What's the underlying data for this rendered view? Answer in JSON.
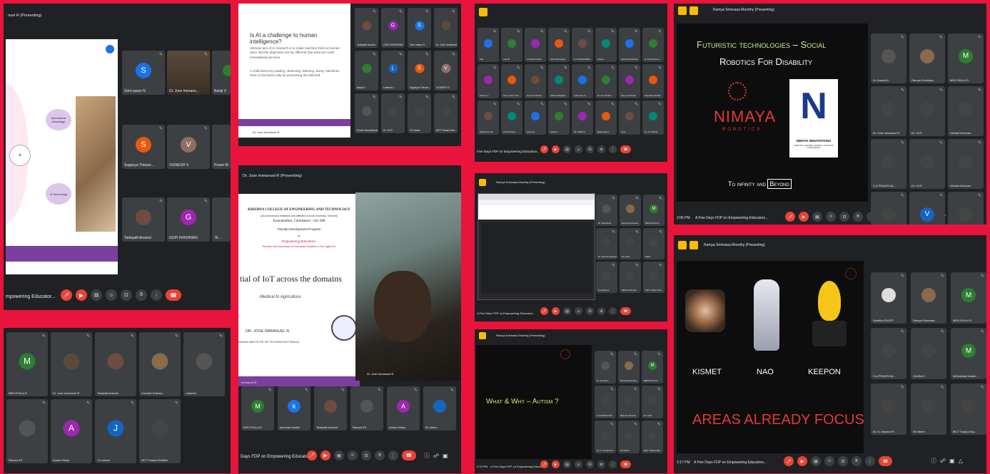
{
  "colors": {
    "background": "#e8143c",
    "panel": "#202124",
    "tile": "#3c4043",
    "end_call": "#ea4335"
  },
  "p1": {
    "presenting": "nuel R (Presenting)",
    "bar_text": "mpowering Educator...",
    "slide": {
      "label_1": "Mechanical Advantage",
      "label_2": "of Technology",
      "label_3": "e"
    },
    "tiles": [
      {
        "name": "Srini vasan N",
        "initial": "S",
        "color": "#1a73e8"
      },
      {
        "name": "Dr. Jose Immanu...",
        "initial": "",
        "color": "#5a4a3a"
      },
      {
        "name": "Balaji V",
        "initial": "",
        "color": "#2e7d32"
      },
      {
        "name": "Suganya Thiruve...",
        "initial": "S",
        "color": "#e8590c"
      },
      {
        "name": "VIGNESH V",
        "initial": "V",
        "color": "#8d6e63"
      },
      {
        "name": "Pravin M",
        "initial": "",
        "color": "#555"
      },
      {
        "name": "Tadepalli Aravind",
        "initial": "",
        "color": "#555"
      },
      {
        "name": "GOPI KRISHNAN",
        "initial": "G",
        "color": "#9c27b0"
      },
      {
        "name": "76 ...",
        "initial": "",
        "color": "#555"
      }
    ]
  },
  "p2": {
    "slide_title": "Is AI a challenge to human intelligence?",
    "para_1": "Ultimate aim of AI research is to make machine think as human does. But the objectives are far different that what we could immediately perceive.",
    "para_2": "A child learns by reading, observing, listening, doing. Machines have so far learnt only by processing the data fed.",
    "footer": "Dr. Jose Immanuel R",
    "tiles": [
      {
        "name": "Tadepalli Aravind",
        "initial": "",
        "color": "#6d4c41"
      },
      {
        "name": "GOPI KRISHNAN",
        "initial": "G",
        "color": "#9c27b0"
      },
      {
        "name": "Srini vasan N",
        "initial": "S",
        "color": "#1a73e8"
      },
      {
        "name": "Dr. Jose Immanuel",
        "initial": "",
        "color": "#5a4a3a"
      },
      {
        "name": "Balaji V",
        "initial": "",
        "color": "#2e7d32"
      },
      {
        "name": "Lakshmi J",
        "initial": "L",
        "color": "#1565c0"
      },
      {
        "name": "Suganya Thiruve...",
        "initial": "S",
        "color": "#e8590c"
      },
      {
        "name": "VIGNESH V",
        "initial": "V",
        "color": "#8d6e63"
      },
      {
        "name": "Pravin Marudachal...",
        "initial": "",
        "color": "#555"
      },
      {
        "name": "Dr. HCS",
        "initial": "",
        "color": "#444"
      },
      {
        "name": "76 others",
        "initial": "",
        "color": "#444"
      },
      {
        "name": "MCT Today's Bul...",
        "initial": "",
        "color": "#444"
      }
    ]
  },
  "p3": {
    "presenting": "Dr. Jose Immanuel R (Presenting)",
    "college": "KRISHNA COLLEGE OF ENGINEERING AND TECHNOLOGY",
    "college_sub": "(An Autonomous Institution and affiliated to Anna University, Chennai)",
    "city": "Kuniamuthur, Coimbatore - 641 008",
    "program": "Faculty Development Program",
    "on": "on",
    "topic": "Empowering Educators:",
    "topic_sub": "Robotics and Automation for Innovative Initiatives in the Digital Era",
    "headline": "tial of IoT across the domains",
    "sub_headline": "Medical to Agriculture",
    "speaker": "DR. JOSE IMMANUEL R.",
    "institute": "INDIAN INSTITUTE OF TECHNOLOGY BHILAI",
    "cam_label": "Dr. Jose Immanuel R",
    "footer_left": "Immanuel R",
    "bar_text": "Days FDP on Empowering Educator...",
    "tiles": [
      {
        "name": "MRUTHULA R",
        "initial": "M",
        "color": "#2e7d32"
      },
      {
        "name": "kammari swathi",
        "initial": "k",
        "color": "#1a73e8"
      },
      {
        "name": "Tadepalli Aravind",
        "initial": "",
        "color": "#6d4c41"
      },
      {
        "name": "Raman KS",
        "initial": "",
        "color": "#555"
      },
      {
        "name": "Amara Starly",
        "initial": "A",
        "color": "#9c27b0"
      },
      {
        "name": "81 others",
        "initial": "",
        "color": "#1565c0"
      }
    ]
  },
  "p4": {
    "tiles": [
      {
        "name": "MRUTHULA R",
        "initial": "M",
        "color": "#2e7d32"
      },
      {
        "name": "Dr. Jose Immanuel R",
        "initial": "",
        "color": "#5a4a3a"
      },
      {
        "name": "Tadepalli Aravind",
        "initial": "",
        "color": "#6d4c41"
      },
      {
        "name": "Sumathi Krishna...",
        "initial": "",
        "color": "#8a6a4a"
      },
      {
        "name": "Lakshmi",
        "initial": "",
        "color": "#555"
      },
      {
        "name": "Raman KS",
        "initial": "",
        "color": "#555"
      },
      {
        "name": "Amara Starly",
        "initial": "A",
        "color": "#9c27b0"
      },
      {
        "name": "J D others",
        "initial": "J",
        "color": "#1565c0"
      },
      {
        "name": "MCT Today's Bulletin",
        "initial": "",
        "color": "#444"
      }
    ]
  },
  "p5": {
    "bar_text": "Five Days FDP on Empowering Educators...",
    "tiles": [
      "ICE",
      "Anju B",
      "Anuharini Sivan",
      "Ashmitha Rajan",
      "S. KATHIGAISEL...",
      "Cleiton",
      "Ajeshma Krishnan",
      "S. Aravind Kum...",
      "Pranav C",
      "Arjun Prem Kum...",
      "Kavya Krishnan",
      "Sahana Raghav",
      "Anbumani S...",
      "Dr. R.V. Prithvi...",
      "Kavya Krishnan",
      "Sweethie Karthik",
      "Suresh Kumar",
      "Aravind Kum...",
      "Kavya R",
      "Ashwin...",
      "Mr. ARUN V",
      "Basavaraj V...",
      "Sree...",
      "Dr. H.C.Sekar"
    ]
  },
  "p6": {
    "presenting": "Ramya Srinivasa Moorthy (Presenting)",
    "tiles": [
      {
        "name": "Dr. Arasi Rani",
        "initial": "",
        "color": "#555"
      },
      {
        "name": "Ramya Srinivasa...",
        "initial": "",
        "color": "#8a6a4a"
      },
      {
        "name": "MRUTHULA R",
        "initial": "M",
        "color": "#2e7d32"
      },
      {
        "name": "Dr. Jose Immanuel R",
        "initial": "",
        "color": "#444"
      },
      {
        "name": "Dr. HCS",
        "initial": "",
        "color": "#444"
      },
      {
        "name": "Nikhil",
        "initial": "",
        "color": "#444"
      },
      {
        "name": "S.A.Ramya",
        "initial": "",
        "color": "#444"
      },
      {
        "name": "Mithra Krishnan",
        "initial": "",
        "color": "#444"
      },
      {
        "name": "MCT Today's Bul...",
        "initial": "",
        "color": "#444"
      }
    ],
    "bar_text": "A Five Days FDP on Empowering Educators..."
  },
  "p7": {
    "presenting": "Ramya Srinivasa Moorthy (Presenting)",
    "slide_title_1": "Futuristic technologies",
    "slide_dash": "–",
    "slide_title_2": "Social",
    "slide_title_3": "Robotics For Disability",
    "logo_1": "NIMAYA",
    "logo_1_sub": "ROBOTICS",
    "logo_2": "NIMAYA INNOVATIONS",
    "logo_2_sub": "ROBOTICS • MACHINE LEARNING • ARTIFICIAL INTELLIGENCE",
    "tagline_1": "To infinity and",
    "tagline_2": "Beyond",
    "time": "2:05 PM",
    "bar_text": "A Five Days FDP on Empowering Educators...",
    "tiles": [
      {
        "name": "Dr. Anandi K",
        "initial": "",
        "color": "#555"
      },
      {
        "name": "Ramya Srinivasa...",
        "initial": "",
        "color": "#8a6a4a"
      },
      {
        "name": "MRUTHULA R",
        "initial": "M",
        "color": "#2e7d32"
      },
      {
        "name": "Dr. Jose Immanuel R",
        "initial": "",
        "color": "#444"
      },
      {
        "name": "Dr. HCS",
        "initial": "",
        "color": "#444"
      },
      {
        "name": "Venkat Krishnan",
        "initial": "",
        "color": "#444"
      },
      {
        "name": "S.A.PRAVIN BA...",
        "initial": "",
        "color": "#444"
      },
      {
        "name": "Dr. HCS",
        "initial": "",
        "color": "#444"
      },
      {
        "name": "Venkat Krishnan",
        "initial": "",
        "color": "#444"
      },
      {
        "name": "Dr. N. Anusha Pr...",
        "initial": "",
        "color": "#444"
      },
      {
        "name": "43 others",
        "initial": "V",
        "color": "#1565c0"
      },
      {
        "name": "MCT Today's Bul...",
        "initial": "",
        "color": "#444"
      }
    ]
  },
  "p8": {
    "slide_title": "What & Why – Autism ?",
    "bar_text": "A Five Days FDP on Empowering Educators...",
    "time": "2:13 PM",
    "presenting": "Ramya Srinivasa Moorthy (Presenting)",
    "tiles": [
      {
        "name": "Dr. Anandi K",
        "initial": "",
        "color": "#555"
      },
      {
        "name": "Ramya Srinivasa...",
        "initial": "",
        "color": "#8a6a4a"
      },
      {
        "name": "MRUTHULA R",
        "initial": "M",
        "color": "#2e7d32"
      },
      {
        "name": "S.A.PRAVIN BA...",
        "initial": "",
        "color": "#444"
      },
      {
        "name": "Bhavani Sharma",
        "initial": "",
        "color": "#444"
      },
      {
        "name": "Dr. HCS",
        "initial": "",
        "color": "#444"
      },
      {
        "name": "Dr. N. Anusha Pr...",
        "initial": "",
        "color": "#444"
      },
      {
        "name": "43 others",
        "initial": "",
        "color": "#444"
      },
      {
        "name": "MCT Today's Bul...",
        "initial": "",
        "color": "#444"
      }
    ]
  },
  "p9": {
    "presenting": "Ramya Srinivasa Moorthy (Presenting)",
    "robot_1": "KISMET",
    "robot_2": "NAO",
    "robot_3": "KEEPON",
    "slide_title": "AREAS ALREADY FOCUSED",
    "time": "2:17 PM",
    "bar_text": "A Five Days FDP on Empowering Educators...",
    "tiles": [
      {
        "name": "Sumitha DUCET",
        "initial": "",
        "color": "#ddd"
      },
      {
        "name": "Ramya Srinivasa...",
        "initial": "",
        "color": "#8a6a4a"
      },
      {
        "name": "MRUTHULA R",
        "initial": "M",
        "color": "#2e7d32"
      },
      {
        "name": "S.A.PRAVIN BA...",
        "initial": "",
        "color": "#444"
      },
      {
        "name": "Geetha D",
        "initial": "",
        "color": "#444"
      },
      {
        "name": "Meherlatah Assist...",
        "initial": "M",
        "color": "#2e7d32"
      },
      {
        "name": "Dr. N. Anusha Pr...",
        "initial": "",
        "color": "#444"
      },
      {
        "name": "39 others",
        "initial": "",
        "color": "#444"
      },
      {
        "name": "MCT Today's Bul...",
        "initial": "",
        "color": "#444"
      }
    ]
  }
}
